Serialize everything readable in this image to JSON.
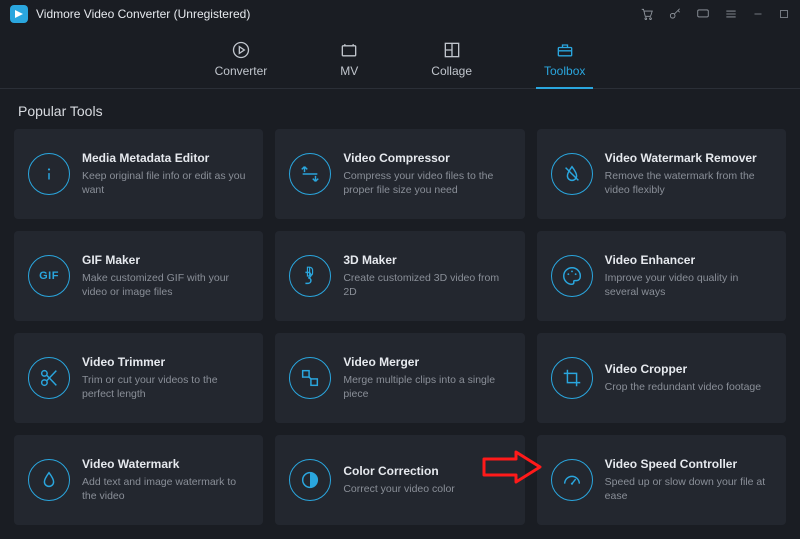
{
  "window": {
    "title": "Vidmore Video Converter (Unregistered)"
  },
  "nav": {
    "items": [
      {
        "label": "Converter"
      },
      {
        "label": "MV"
      },
      {
        "label": "Collage"
      },
      {
        "label": "Toolbox"
      }
    ]
  },
  "section": {
    "title": "Popular Tools"
  },
  "tools": [
    {
      "title": "Media Metadata Editor",
      "desc": "Keep original file info or edit as you want",
      "icon": "info-icon"
    },
    {
      "title": "Video Compressor",
      "desc": "Compress your video files to the proper file size you need",
      "icon": "compress-icon"
    },
    {
      "title": "Video Watermark Remover",
      "desc": "Remove the watermark from the video flexibly",
      "icon": "watermark-remove-icon"
    },
    {
      "title": "GIF Maker",
      "desc": "Make customized GIF with your video or image files",
      "icon": "gif-icon"
    },
    {
      "title": "3D Maker",
      "desc": "Create customized 3D video from 2D",
      "icon": "3d-icon"
    },
    {
      "title": "Video Enhancer",
      "desc": "Improve your video quality in several ways",
      "icon": "palette-icon"
    },
    {
      "title": "Video Trimmer",
      "desc": "Trim or cut your videos to the perfect length",
      "icon": "scissors-icon"
    },
    {
      "title": "Video Merger",
      "desc": "Merge multiple clips into a single piece",
      "icon": "merge-icon"
    },
    {
      "title": "Video Cropper",
      "desc": "Crop the redundant video footage",
      "icon": "crop-icon"
    },
    {
      "title": "Video Watermark",
      "desc": "Add text and image watermark to the video",
      "icon": "watermark-icon"
    },
    {
      "title": "Color Correction",
      "desc": "Correct your video color",
      "icon": "color-icon"
    },
    {
      "title": "Video Speed Controller",
      "desc": "Speed up or slow down your file at ease",
      "icon": "speed-icon"
    }
  ]
}
